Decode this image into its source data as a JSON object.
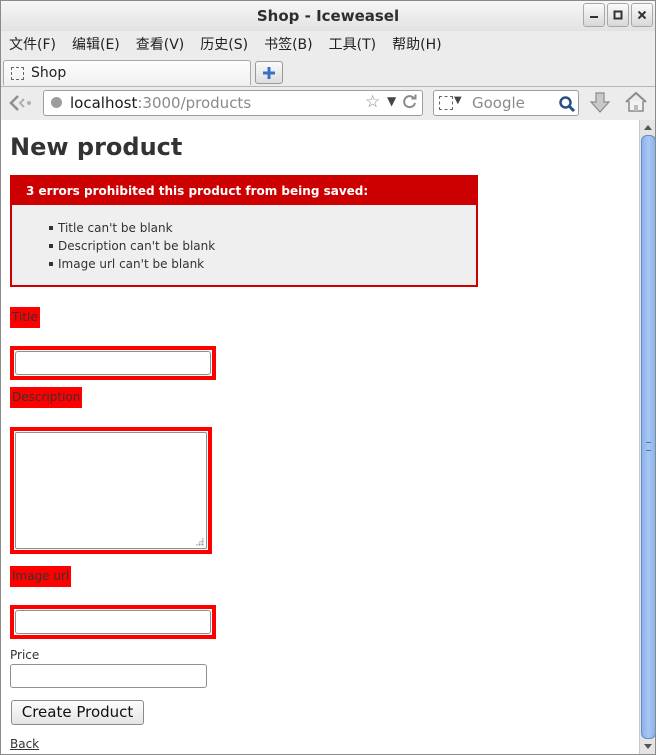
{
  "window": {
    "title": "Shop - Iceweasel"
  },
  "menubar": {
    "items": [
      "文件(F)",
      "编辑(E)",
      "查看(V)",
      "历史(S)",
      "书签(B)",
      "工具(T)",
      "帮助(H)"
    ]
  },
  "tabs": [
    {
      "label": "Shop",
      "active": true
    }
  ],
  "navbar": {
    "url_host": "localhost",
    "url_path": ":3000/products",
    "search_placeholder": "Google"
  },
  "page": {
    "heading": "New product",
    "errors": {
      "header": "3 errors prohibited this product from being saved:",
      "items": [
        "Title can't be blank",
        "Description can't be blank",
        "Image url can't be blank"
      ]
    },
    "form": {
      "title_label": "Title",
      "description_label": "Description",
      "image_url_label": "Image url",
      "price_label": "Price",
      "title_value": "",
      "description_value": "",
      "image_url_value": "",
      "price_value": "",
      "submit_label": "Create Product"
    },
    "back_link": "Back"
  },
  "colors": {
    "error_red": "#cc0000",
    "field_error_red": "#ff0000",
    "scroll_thumb": "#a9c7f2"
  }
}
